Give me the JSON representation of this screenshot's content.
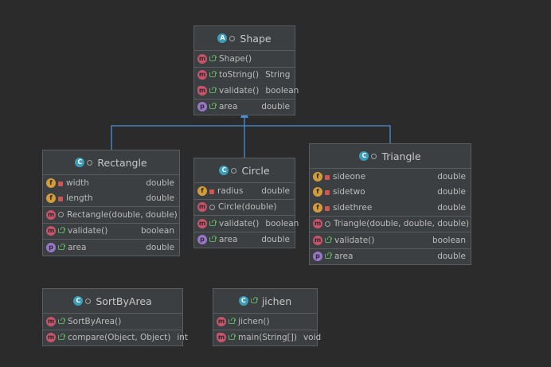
{
  "classes": {
    "shape": {
      "name": "Shape",
      "members": {
        "constructor": "Shape()",
        "toString": {
          "label": "toString()",
          "type": "String"
        },
        "validate": {
          "label": "validate()",
          "type": "boolean"
        },
        "area": {
          "label": "area",
          "type": "double"
        }
      }
    },
    "rectangle": {
      "name": "Rectangle",
      "fields": [
        {
          "label": "width",
          "type": "double"
        },
        {
          "label": "length",
          "type": "double"
        }
      ],
      "constructor": "Rectangle(double, double)",
      "validate": {
        "label": "validate()",
        "type": "boolean"
      },
      "area": {
        "label": "area",
        "type": "double"
      }
    },
    "circle": {
      "name": "Circle",
      "fields": [
        {
          "label": "radius",
          "type": "double"
        }
      ],
      "constructor": "Circle(double)",
      "validate": {
        "label": "validate()",
        "type": "boolean"
      },
      "area": {
        "label": "area",
        "type": "double"
      }
    },
    "triangle": {
      "name": "Triangle",
      "fields": [
        {
          "label": "sideone",
          "type": "double"
        },
        {
          "label": "sidetwo",
          "type": "double"
        },
        {
          "label": "sidethree",
          "type": "double"
        }
      ],
      "constructor": "Triangle(double, double, double)",
      "validate": {
        "label": "validate()",
        "type": "boolean"
      },
      "area": {
        "label": "area",
        "type": "double"
      }
    },
    "sortByArea": {
      "name": "SortByArea",
      "constructor": "SortByArea()",
      "compare": {
        "label": "compare(Object, Object)",
        "type": "int"
      }
    },
    "jichen": {
      "name": "jichen",
      "constructor": "jichen()",
      "main": {
        "label": "main(String[])",
        "type": "void"
      }
    }
  },
  "icons": {
    "class": "C",
    "abstract": "A",
    "method": "m",
    "field": "f",
    "property": "p"
  },
  "colors": {
    "background": "#2b2b2b",
    "node": "#3c3f41",
    "inheritance_arrow": "#4a8fd6",
    "method_icon": "#c8546b",
    "field_icon": "#d39b3a",
    "property_icon": "#9876c9",
    "class_icon": "#3c9db8"
  }
}
